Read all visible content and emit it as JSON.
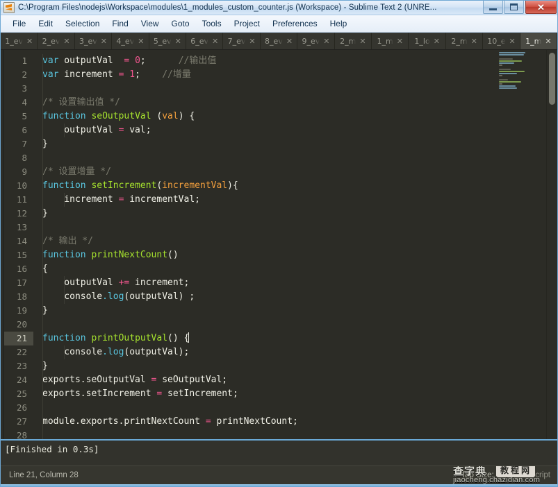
{
  "window": {
    "title": "C:\\Program Files\\nodejs\\Workspace\\modules\\1_modules_custom_counter.js (Workspace) - Sublime Text 2 (UNRE...",
    "app_icon": "sublime-text-icon",
    "controls": {
      "minimize": "minimize-icon",
      "maximize": "maximize-icon",
      "close": "✕"
    }
  },
  "menubar": {
    "items": [
      {
        "label": "File"
      },
      {
        "label": "Edit"
      },
      {
        "label": "Selection"
      },
      {
        "label": "Find"
      },
      {
        "label": "View"
      },
      {
        "label": "Goto"
      },
      {
        "label": "Tools"
      },
      {
        "label": "Project"
      },
      {
        "label": "Preferences"
      },
      {
        "label": "Help"
      }
    ]
  },
  "tabbar": {
    "close_glyph": "✕",
    "tabs": [
      {
        "label": "1_ev",
        "active": false
      },
      {
        "label": "2_ev",
        "active": false
      },
      {
        "label": "3_ev",
        "active": false
      },
      {
        "label": "4_ev",
        "active": false
      },
      {
        "label": "5_ev",
        "active": false
      },
      {
        "label": "6_ev",
        "active": false
      },
      {
        "label": "7_ev",
        "active": false
      },
      {
        "label": "8_ev",
        "active": false
      },
      {
        "label": "9_ev",
        "active": false
      },
      {
        "label": "2_m",
        "active": false
      },
      {
        "label": "1_m",
        "active": false
      },
      {
        "label": "1_lo",
        "active": false
      },
      {
        "label": "2_m",
        "active": false
      },
      {
        "label": "10_e",
        "active": false
      },
      {
        "label": "1_m",
        "active": true
      }
    ]
  },
  "editor": {
    "active_line": 21,
    "total_lines": 28,
    "colors": {
      "background": "#2c2c26",
      "foreground": "#f0f0e6",
      "keyword": "#5ac6e0",
      "function": "#a6e22e",
      "parameter": "#f29f3d",
      "number": "#f3568f",
      "operator": "#f3568f",
      "comment": "#7b7b6e",
      "gutter_text": "#8d8d80",
      "active_line_bg": "#4a4a41"
    },
    "lines": [
      {
        "n": 1,
        "tokens": [
          {
            "t": "var",
            "c": "kw"
          },
          {
            "t": " outputVal  ",
            "c": "punc"
          },
          {
            "t": "=",
            "c": "op"
          },
          {
            "t": " ",
            "c": "punc"
          },
          {
            "t": "0",
            "c": "num"
          },
          {
            "t": ";",
            "c": "punc"
          },
          {
            "t": "      ",
            "c": "punc"
          },
          {
            "t": "//输出值",
            "c": "cmt"
          }
        ]
      },
      {
        "n": 2,
        "tokens": [
          {
            "t": "var",
            "c": "kw"
          },
          {
            "t": " increment ",
            "c": "punc"
          },
          {
            "t": "=",
            "c": "op"
          },
          {
            "t": " ",
            "c": "punc"
          },
          {
            "t": "1",
            "c": "num"
          },
          {
            "t": ";",
            "c": "punc"
          },
          {
            "t": "    ",
            "c": "punc"
          },
          {
            "t": "//增量",
            "c": "cmt"
          }
        ]
      },
      {
        "n": 3,
        "tokens": []
      },
      {
        "n": 4,
        "tokens": [
          {
            "t": "/* 设置输出值 */",
            "c": "cmt"
          }
        ]
      },
      {
        "n": 5,
        "tokens": [
          {
            "t": "function",
            "c": "kw"
          },
          {
            "t": " ",
            "c": "punc"
          },
          {
            "t": "seOutputVal",
            "c": "fn"
          },
          {
            "t": " (",
            "c": "punc"
          },
          {
            "t": "val",
            "c": "param"
          },
          {
            "t": ") {",
            "c": "punc"
          }
        ]
      },
      {
        "n": 6,
        "tokens": [
          {
            "t": "    outputVal ",
            "c": "punc"
          },
          {
            "t": "=",
            "c": "op"
          },
          {
            "t": " val;",
            "c": "punc"
          }
        ]
      },
      {
        "n": 7,
        "tokens": [
          {
            "t": "}",
            "c": "punc"
          }
        ]
      },
      {
        "n": 8,
        "tokens": []
      },
      {
        "n": 9,
        "tokens": [
          {
            "t": "/* 设置增量 */",
            "c": "cmt"
          }
        ]
      },
      {
        "n": 10,
        "tokens": [
          {
            "t": "function",
            "c": "kw"
          },
          {
            "t": " ",
            "c": "punc"
          },
          {
            "t": "setIncrement",
            "c": "fn"
          },
          {
            "t": "(",
            "c": "punc"
          },
          {
            "t": "incrementVal",
            "c": "param"
          },
          {
            "t": "){",
            "c": "punc"
          }
        ]
      },
      {
        "n": 11,
        "tokens": [
          {
            "t": "    increment ",
            "c": "punc"
          },
          {
            "t": "=",
            "c": "op"
          },
          {
            "t": " incrementVal;",
            "c": "punc"
          }
        ]
      },
      {
        "n": 12,
        "tokens": [
          {
            "t": "}",
            "c": "punc"
          }
        ]
      },
      {
        "n": 13,
        "tokens": []
      },
      {
        "n": 14,
        "tokens": [
          {
            "t": "/* 输出 */",
            "c": "cmt"
          }
        ]
      },
      {
        "n": 15,
        "tokens": [
          {
            "t": "function",
            "c": "kw"
          },
          {
            "t": " ",
            "c": "punc"
          },
          {
            "t": "printNextCount",
            "c": "fn"
          },
          {
            "t": "()",
            "c": "punc"
          }
        ]
      },
      {
        "n": 16,
        "tokens": [
          {
            "t": "{",
            "c": "punc"
          }
        ]
      },
      {
        "n": 17,
        "tokens": [
          {
            "t": "    outputVal ",
            "c": "punc"
          },
          {
            "t": "+=",
            "c": "op"
          },
          {
            "t": " increment;",
            "c": "punc"
          }
        ]
      },
      {
        "n": 18,
        "tokens": [
          {
            "t": "    console",
            "c": "punc"
          },
          {
            "t": ".log",
            "c": "prop"
          },
          {
            "t": "(outputVal) ;",
            "c": "punc"
          }
        ]
      },
      {
        "n": 19,
        "tokens": [
          {
            "t": "}",
            "c": "punc"
          }
        ]
      },
      {
        "n": 20,
        "tokens": []
      },
      {
        "n": 21,
        "tokens": [
          {
            "t": "function",
            "c": "kw"
          },
          {
            "t": " ",
            "c": "punc"
          },
          {
            "t": "printOutputVal",
            "c": "fn"
          },
          {
            "t": "() {",
            "c": "punc"
          }
        ],
        "cursor": true
      },
      {
        "n": 22,
        "tokens": [
          {
            "t": "    console",
            "c": "punc"
          },
          {
            "t": ".log",
            "c": "prop"
          },
          {
            "t": "(outputVal);",
            "c": "punc"
          }
        ]
      },
      {
        "n": 23,
        "tokens": [
          {
            "t": "}",
            "c": "punc"
          }
        ]
      },
      {
        "n": 24,
        "tokens": [
          {
            "t": "exports.seOutputVal ",
            "c": "punc"
          },
          {
            "t": "=",
            "c": "op"
          },
          {
            "t": " seOutputVal;",
            "c": "punc"
          }
        ]
      },
      {
        "n": 25,
        "tokens": [
          {
            "t": "exports.setIncrement ",
            "c": "punc"
          },
          {
            "t": "=",
            "c": "op"
          },
          {
            "t": " setIncrement;",
            "c": "punc"
          }
        ]
      },
      {
        "n": 26,
        "tokens": []
      },
      {
        "n": 27,
        "tokens": [
          {
            "t": "module.exports.printNextCount ",
            "c": "punc"
          },
          {
            "t": "=",
            "c": "op"
          },
          {
            "t": " printNextCount;",
            "c": "punc"
          }
        ]
      },
      {
        "n": 28,
        "tokens": []
      }
    ]
  },
  "minimap": {
    "name": "minimap",
    "rows": [
      {
        "w": 58,
        "color": "#6a8ea0"
      },
      {
        "w": 54,
        "color": "#6a8ea0"
      },
      {
        "w": 0,
        "color": "transparent"
      },
      {
        "w": 30,
        "color": "#5a5a50"
      },
      {
        "w": 50,
        "color": "#7d9b4e"
      },
      {
        "w": 34,
        "color": "#6a8ea0"
      },
      {
        "w": 8,
        "color": "#6a6a5c"
      },
      {
        "w": 0,
        "color": "transparent"
      },
      {
        "w": 26,
        "color": "#5a5a50"
      },
      {
        "w": 56,
        "color": "#7d9b4e"
      },
      {
        "w": 40,
        "color": "#6a8ea0"
      },
      {
        "w": 8,
        "color": "#6a6a5c"
      },
      {
        "w": 0,
        "color": "transparent"
      },
      {
        "w": 20,
        "color": "#5a5a50"
      },
      {
        "w": 48,
        "color": "#7d9b4e"
      },
      {
        "w": 8,
        "color": "#6a6a5c"
      },
      {
        "w": 36,
        "color": "#6a8ea0"
      },
      {
        "w": 40,
        "color": "#6a8ea0"
      },
      {
        "w": 8,
        "color": "#6a6a5c"
      },
      {
        "w": 0,
        "color": "transparent"
      },
      {
        "w": 50,
        "color": "#7d9b4e"
      },
      {
        "w": 38,
        "color": "#6a8ea0"
      },
      {
        "w": 8,
        "color": "#6a6a5c"
      },
      {
        "w": 52,
        "color": "#8c8c7e"
      },
      {
        "w": 56,
        "color": "#8c8c7e"
      },
      {
        "w": 0,
        "color": "transparent"
      },
      {
        "w": 64,
        "color": "#8c8c7e"
      }
    ]
  },
  "console": {
    "output": "[Finished in 0.3s]"
  },
  "statusbar": {
    "position": "Line 21, Column 28",
    "tab_size": "Tab Size: 4",
    "syntax": "JavaScript"
  },
  "watermark": {
    "brand_cn": "查字典",
    "badge_cn": "教程网",
    "url": "jiaocheng.chazidian.com"
  }
}
